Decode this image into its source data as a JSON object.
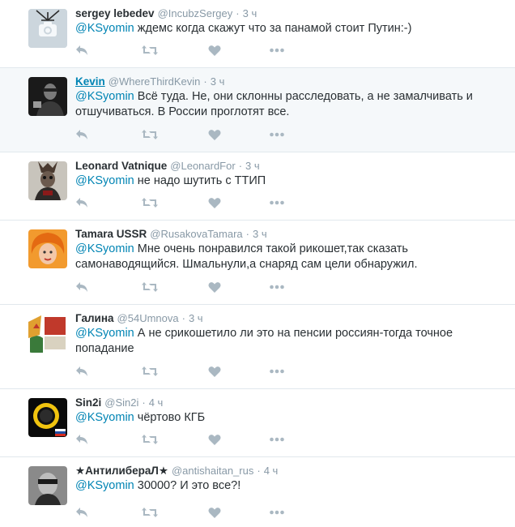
{
  "time_separator": "·",
  "colors": {
    "link": "#0084b4",
    "muted": "#8899a6",
    "icon": "#aab8c2",
    "highlight_bg": "#f5f8fa"
  },
  "icons": {
    "reply": "reply-icon",
    "retweet": "retweet-icon",
    "like": "heart-icon",
    "more": "more-icon"
  },
  "tweets": [
    {
      "name": "sergey lebedev",
      "handle": "@IncubzSergey",
      "time": "3 ч",
      "mention": "@KSyomin",
      "text": " ждемс когда скажут что за панамой стоит Путин:-)"
    },
    {
      "name": "Kevin",
      "handle": "@WhereThirdKevin",
      "time": "3 ч",
      "mention": "@KSyomin",
      "text": " Всё туда. Не, они склонны расследовать, а не замалчивать и отшучиваться. В России проглотят все."
    },
    {
      "name": "Leonard Vatnique",
      "handle": "@LeonardFor",
      "time": "3 ч",
      "mention": "@KSyomin",
      "text": " не надо шутить с ТТИП"
    },
    {
      "name": "Tamara USSR",
      "handle": "@RusakovaTamara",
      "time": "3 ч",
      "mention": "@KSyomin",
      "text": " Мне очень понравился такой рикошет,так сказать самонаводящийся. Шмальнули,а снаряд сам цели обнаружил."
    },
    {
      "name": "Галина",
      "handle": "@54Umnova",
      "time": "3 ч",
      "mention": "@KSyomin",
      "text": " А не срикошетило ли это на пенсии россиян-тогда точное попадание"
    },
    {
      "name": "Sin2i",
      "handle": "@Sin2i",
      "time": "4 ч",
      "mention": "@KSyomin",
      "text": " чёртово КГБ"
    },
    {
      "name": "★АнтилибераЛ★",
      "handle": "@antishaitan_rus",
      "time": "4 ч",
      "mention": "@KSyomin",
      "text": " 30000? И это все?!"
    }
  ]
}
